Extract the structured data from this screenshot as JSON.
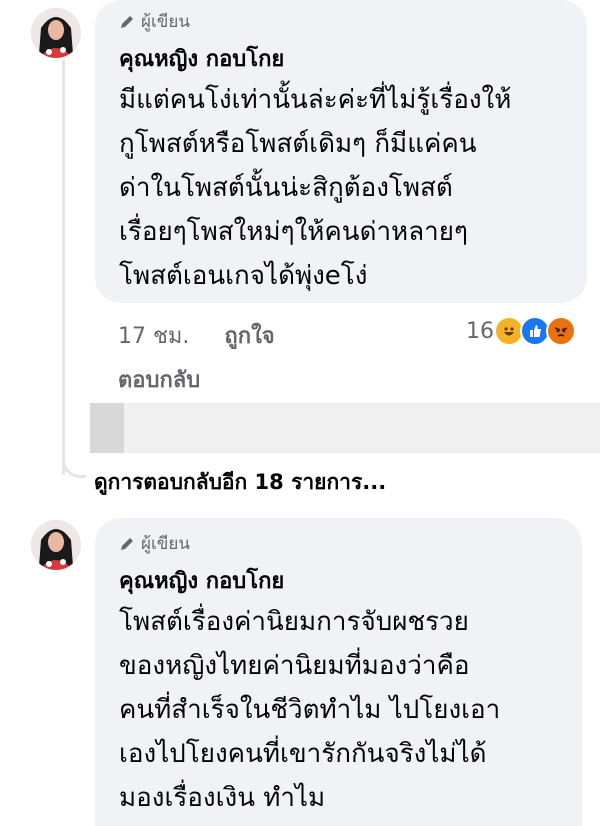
{
  "comments": [
    {
      "badge": "ผู้เขียน",
      "author": "คุณหญิง กอบโกย",
      "lines": [
        "มีแต่คนโง่เท่านั้นล่ะค่ะที่ไม่รู้เรื่องให้",
        "กูโพสต์หรือโพสต์เดิมๆ ก็มีแค่คน",
        "ด่าในโพสต์นั้นน่ะสิกูต้องโพสต์",
        "เรื่อยๆโพสใหม่ๆให้คนด่าหลายๆ",
        "โพสต์เอนเกจได้พุ่งeโง่"
      ],
      "time": "17 ชม.",
      "like_label": "ถูกใจ",
      "reply_label": "ตอบกลับ",
      "reaction_count": "16",
      "reactions": [
        "haha-icon",
        "like-icon",
        "angry-icon"
      ]
    },
    {
      "badge": "ผู้เขียน",
      "author": "คุณหญิง กอบโกย",
      "lines": [
        "โพสต์เรื่องค่านิยมการจับผชรวย",
        "ของหญิงไทยค่านิยมที่มองว่าคือ",
        "คนที่สำเร็จในชีวิตทำไม ไปโยงเอา",
        "เองไปโยงคนที่เขารักกันจริงไม่ได้",
        "มองเรื่องเงิน ทำไม"
      ]
    }
  ],
  "more_replies": "ดูการตอบกลับอีก 18 รายการ...",
  "colors": {
    "bubble": "#f0f2f5",
    "meta": "#65676b",
    "like_blue": "#1877f2",
    "angry": "#e9710f",
    "haha": "#f7b125"
  }
}
